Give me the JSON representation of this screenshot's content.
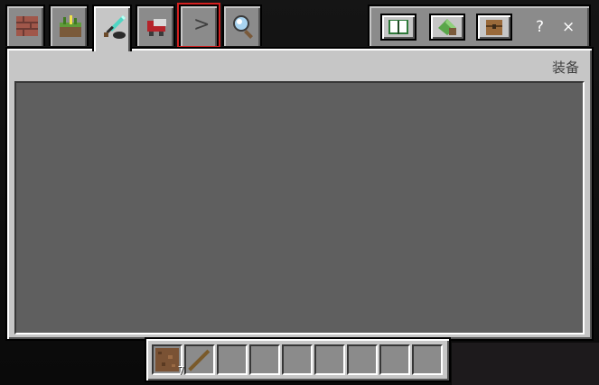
{
  "panel": {
    "title": "装备"
  },
  "tabs": [
    {
      "name": "building-blocks",
      "icon": "bricks-icon"
    },
    {
      "name": "decorations",
      "icon": "grass-block-icon"
    },
    {
      "name": "combat",
      "icon": "diamond-sword-icon",
      "selected": true
    },
    {
      "name": "redstone-transport",
      "icon": "minecart-icon"
    },
    {
      "name": "next-page",
      "label": ">",
      "highlighted": true
    },
    {
      "name": "search",
      "icon": "magnifier-icon"
    }
  ],
  "right_controls": {
    "book_label": "book",
    "help_label": "?",
    "close_label": "×"
  },
  "hotbar": {
    "slots": [
      {
        "item": "dirt-block-icon",
        "count": "7"
      },
      {
        "item": "stick-icon",
        "count": ""
      },
      {
        "item": "",
        "count": ""
      },
      {
        "item": "",
        "count": ""
      },
      {
        "item": "",
        "count": ""
      },
      {
        "item": "",
        "count": ""
      },
      {
        "item": "",
        "count": ""
      },
      {
        "item": "",
        "count": ""
      },
      {
        "item": "",
        "count": ""
      }
    ]
  },
  "colors": {
    "panel": "#c6c6c6",
    "slot": "#8b8b8b",
    "list_bg": "#5f5f5f",
    "highlight": "#d42020"
  }
}
